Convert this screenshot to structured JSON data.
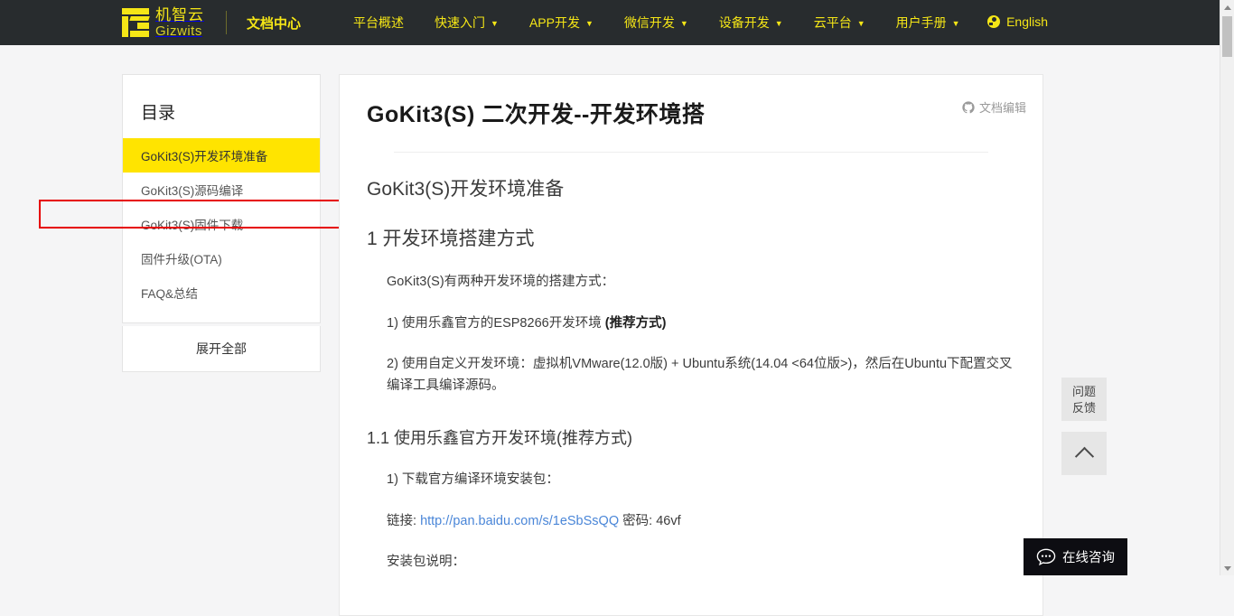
{
  "header": {
    "logo_cn": "机智云",
    "logo_en": "Gizwits",
    "brand": "文档中心",
    "nav_items": [
      {
        "label": "平台概述",
        "caret": false
      },
      {
        "label": "快速入门",
        "caret": true
      },
      {
        "label": "APP开发",
        "caret": true
      },
      {
        "label": "微信开发",
        "caret": true
      },
      {
        "label": "设备开发",
        "caret": true
      },
      {
        "label": "云平台",
        "caret": true
      },
      {
        "label": "用户手册",
        "caret": true
      }
    ],
    "caret_glyph": "▼",
    "language": "English",
    "accent_color": "#f5e616",
    "bar_color": "#282c2e"
  },
  "sidebar": {
    "title": "目录",
    "items": [
      {
        "label": "GoKit3(S)开发环境准备",
        "active": true
      },
      {
        "label": "GoKit3(S)源码编译",
        "active": false
      },
      {
        "label": "GoKit3(S)固件下载",
        "active": false
      },
      {
        "label": "固件升级(OTA)",
        "active": false
      },
      {
        "label": "FAQ&总结",
        "active": false
      }
    ],
    "expand_all": "展开全部",
    "highlight_color": "#ffe400",
    "annotation_color": "#e60000"
  },
  "document": {
    "title": "GoKit3(S) 二次开发--开发环境搭",
    "edit_label": "文档编辑",
    "sections": {
      "h2_prepare": "GoKit3(S)开发环境准备",
      "h2_methods": "1 开发环境搭建方式",
      "p_intro": "GoKit3(S)有两种开发环境的搭建方式：",
      "p_option1_pre": "1) 使用乐鑫官方的ESP8266开发环境 ",
      "p_option1_bold": "(推荐方式)",
      "p_option2": "2) 使用自定义开发环境：虚拟机VMware(12.0版) + Ubuntu系统(14.04 <64位版>)，然后在Ubuntu下配置交叉编译工具编译源码。",
      "h3_official": "1.1 使用乐鑫官方开发环境(推荐方式)",
      "p_download": "1) 下载官方编译环境安装包：",
      "p_link_prefix": "链接: ",
      "p_link_text": "http://pan.baidu.com/s/1eSbSsQQ",
      "p_link_suffix": " 密码: 46vf",
      "p_install_note": "安装包说明："
    }
  },
  "widgets": {
    "feedback_line1": "问题",
    "feedback_line2": "反馈",
    "scroll_top_icon": "chevron-up-icon",
    "chat_label": "在线咨询"
  }
}
